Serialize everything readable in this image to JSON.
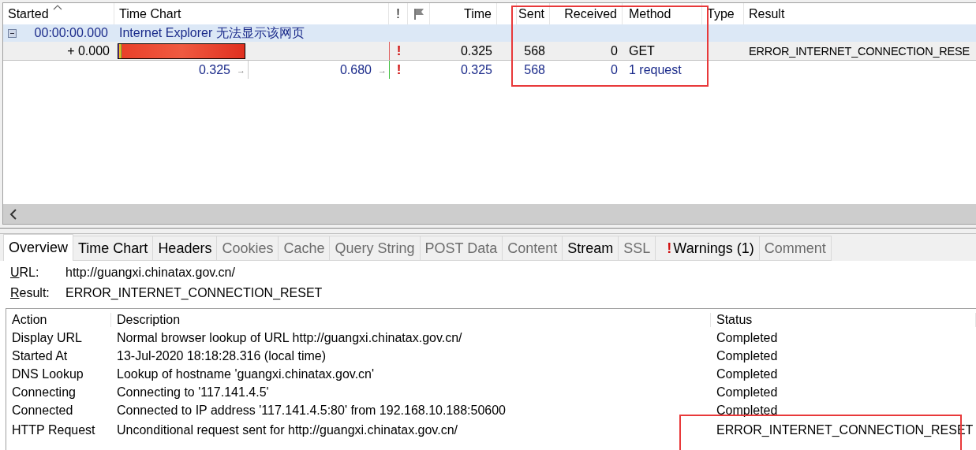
{
  "sessions": {
    "columns": [
      {
        "label": "Started",
        "sorted": true
      },
      {
        "label": "Time Chart"
      },
      {
        "label": "!"
      },
      {
        "kind": "flag"
      },
      {
        "label": "Time"
      },
      {
        "kind": "blank"
      },
      {
        "label": "Sent"
      },
      {
        "label": "Received"
      },
      {
        "label": "Method"
      },
      {
        "label": "Type"
      },
      {
        "label": "Result"
      }
    ],
    "group": {
      "expanded": true,
      "started": "00:00:00.000",
      "title": "Internet Explorer 无法显示该网页"
    },
    "request": {
      "started": "+ 0.000",
      "warning": "!",
      "time": "0.325",
      "sent": "568",
      "received": "0",
      "method": "GET",
      "result": "ERROR_INTERNET_CONNECTION_RESE"
    },
    "summary": {
      "start": "0.325",
      "start_arrow": "→",
      "end": "0.680",
      "end_arrow": "→",
      "warning": "!",
      "time": "0.325",
      "sent": "568",
      "received": "0",
      "method": "1 request"
    }
  },
  "tabs": [
    {
      "label": "Overview",
      "selected": true,
      "disabled": false
    },
    {
      "label": "Time Chart",
      "selected": false,
      "disabled": false
    },
    {
      "label": "Headers",
      "selected": false,
      "disabled": false
    },
    {
      "label": "Cookies",
      "selected": false,
      "disabled": true
    },
    {
      "label": "Cache",
      "selected": false,
      "disabled": true
    },
    {
      "label": "Query String",
      "selected": false,
      "disabled": true
    },
    {
      "label": "POST Data",
      "selected": false,
      "disabled": true
    },
    {
      "label": "Content",
      "selected": false,
      "disabled": true
    },
    {
      "label": "Stream",
      "selected": false,
      "disabled": false
    },
    {
      "label": "SSL",
      "selected": false,
      "disabled": true
    },
    {
      "label": "Warnings (1)",
      "selected": false,
      "disabled": false,
      "marker": "!"
    },
    {
      "label": "Comment",
      "selected": false,
      "disabled": true
    }
  ],
  "overview": {
    "fields": [
      {
        "label": "URL:",
        "value": "http://guangxi.chinatax.gov.cn/"
      },
      {
        "label": "Result:",
        "value": "ERROR_INTERNET_CONNECTION_RESET"
      }
    ],
    "table": {
      "columns": [
        "Action",
        "Description",
        "Status"
      ],
      "rows": [
        [
          "Display URL",
          "Normal browser lookup of URL http://guangxi.chinatax.gov.cn/",
          "Completed"
        ],
        [
          "Started At",
          "13-Jul-2020 18:18:28.316 (local time)",
          "Completed"
        ],
        [
          "DNS Lookup",
          "Lookup of hostname 'guangxi.chinatax.gov.cn'",
          "Completed"
        ],
        [
          "Connecting",
          "Connecting to '117.141.4.5'",
          "Completed"
        ],
        [
          "Connected",
          "Connected to IP address '117.141.4.5:80' from 192.168.10.188:50600",
          "Completed"
        ],
        [
          "HTTP Request",
          "Unconditional request sent for http://guangxi.chinatax.gov.cn/",
          "ERROR_INTERNET_CONNECTION_RESET"
        ]
      ]
    }
  }
}
